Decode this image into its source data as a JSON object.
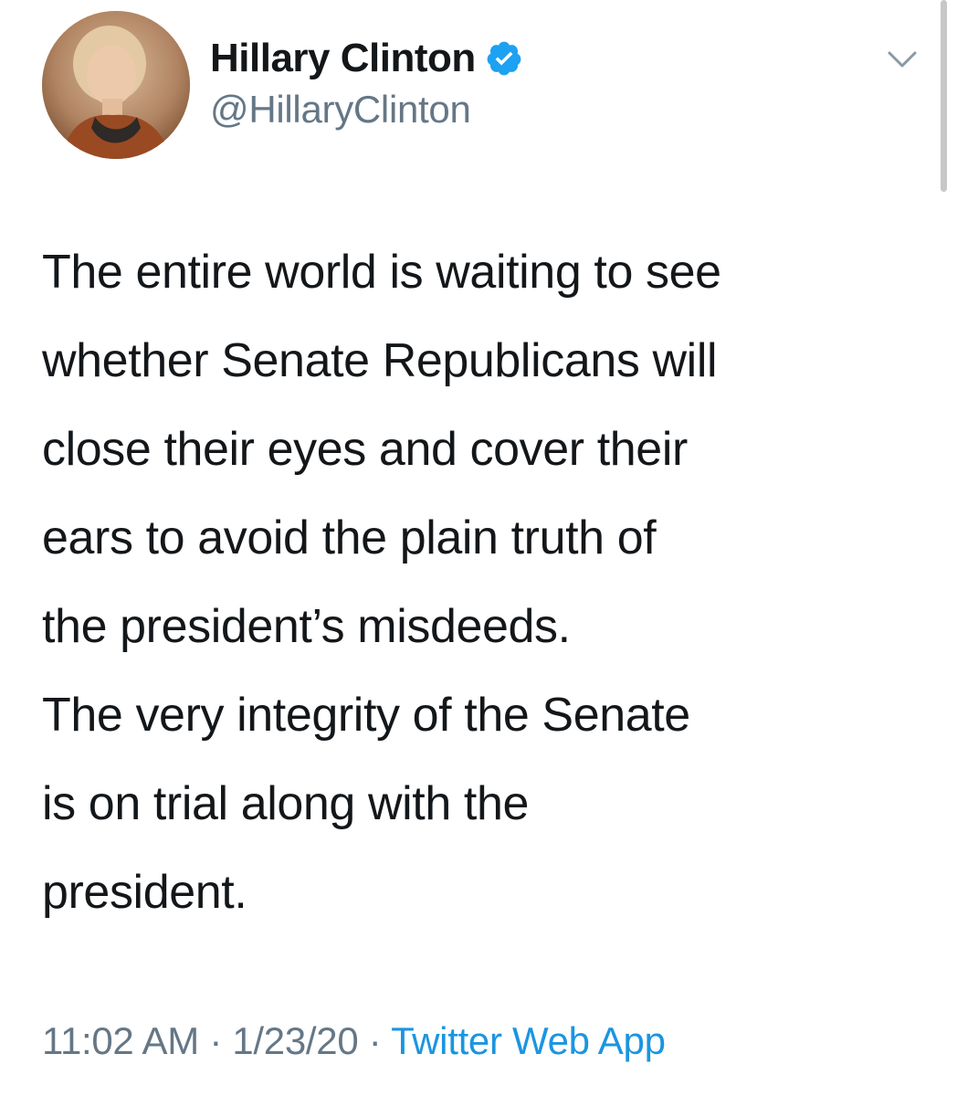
{
  "user": {
    "display_name": "Hillary Clinton",
    "handle": "@HillaryClinton",
    "verified": true,
    "avatar_icon": "profile-photo"
  },
  "tweet": {
    "paragraphs": [
      "The entire world is waiting to see\nwhether Senate Republicans will\nclose their eyes and cover their\nears to avoid the plain truth of\nthe president’s misdeeds.",
      "The very integrity of the Senate\nis on trial along with the\npresident."
    ],
    "time": "11:02 AM",
    "separator": "·",
    "date": "1/23/20",
    "source": "Twitter Web App"
  },
  "colors": {
    "text": "#14171a",
    "secondary": "#657786",
    "accent": "#1b95e0"
  },
  "icons": {
    "verified": "verified-badge-icon",
    "menu": "chevron-down-icon"
  }
}
